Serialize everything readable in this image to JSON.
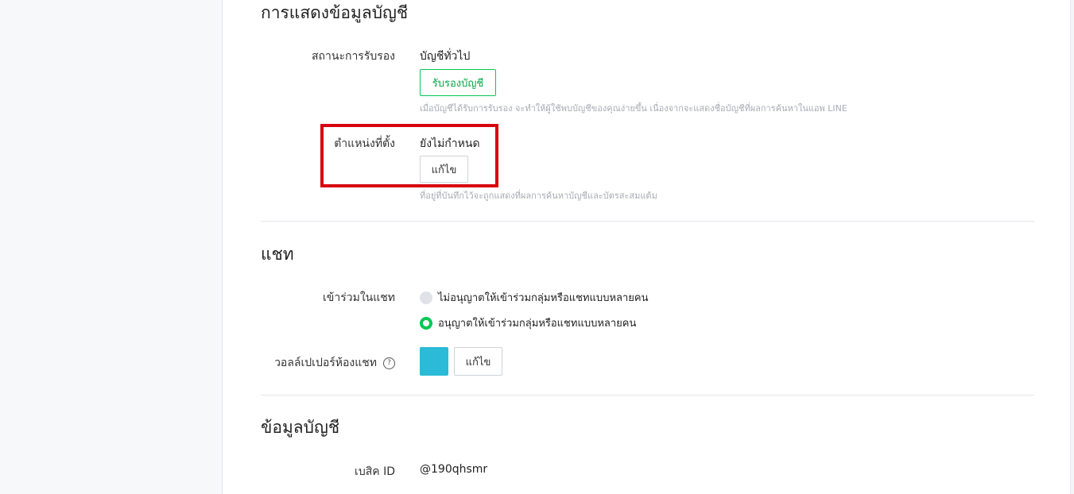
{
  "display_section": {
    "title": "การแสดงข้อมูลบัญชี",
    "verification": {
      "label": "สถานะการรับรอง",
      "value": "บัญชีทั่วไป",
      "button": "รับรองบัญชี",
      "hint": "เมื่อบัญชีได้รับการรับรอง จะทำให้ผู้ใช้พบบัญชีของคุณง่ายขึ้น เนื่องจากจะแสดงชื่อบัญชีที่ผลการค้นหาในแอพ LINE"
    },
    "location": {
      "label": "ตำแหน่งที่ตั้ง",
      "value": "ยังไม่กำหนด",
      "button": "แก้ไข",
      "hint": "ที่อยู่ที่บันทึกไว้จะถูกแสดงที่ผลการค้นหาบัญชีและบัตรสะสมแต้ม"
    }
  },
  "chat_section": {
    "title": "แชท",
    "join_chat": {
      "label": "เข้าร่วมในแชท",
      "options": [
        {
          "label": "ไม่อนุญาตให้เข้าร่วมกลุ่มหรือแชทแบบหลายคน",
          "selected": false
        },
        {
          "label": "อนุญาตให้เข้าร่วมกลุ่มหรือแชทแบบหลายคน",
          "selected": true
        }
      ]
    },
    "wallpaper": {
      "label": "วอลล์เปเปอร์ห้องแชท",
      "help_icon": "?",
      "color": "#2bbbd8",
      "button": "แก้ไข"
    }
  },
  "account_section": {
    "title": "ข้อมูลบัญชี",
    "basic_id": {
      "label": "เบสิค ID",
      "value": "@190qhsmr"
    }
  },
  "colors": {
    "accent_green": "#06c755",
    "highlight_red": "#d7000f"
  }
}
